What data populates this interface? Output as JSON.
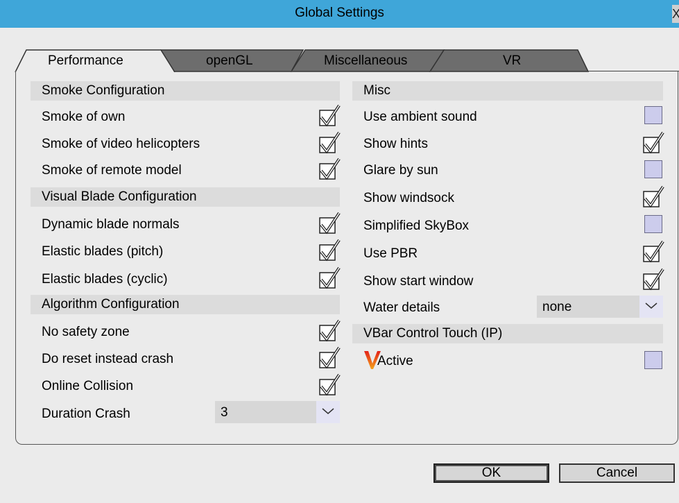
{
  "window": {
    "title": "Global Settings",
    "close_glyph": "X"
  },
  "tabs": [
    {
      "label": "Performance",
      "active": true
    },
    {
      "label": "openGL",
      "active": false
    },
    {
      "label": "Miscellaneous",
      "active": false
    },
    {
      "label": "VR",
      "active": false
    }
  ],
  "left": {
    "smoke": {
      "header": "Smoke Configuration",
      "items": [
        {
          "label": "Smoke of own",
          "checked": true
        },
        {
          "label": "Smoke of video helicopters",
          "checked": true
        },
        {
          "label": "Smoke of remote model",
          "checked": true
        }
      ]
    },
    "blade": {
      "header": "Visual Blade Configuration",
      "items": [
        {
          "label": "Dynamic blade normals",
          "checked": true
        },
        {
          "label": "Elastic blades (pitch)",
          "checked": true
        },
        {
          "label": "Elastic blades (cyclic)",
          "checked": true
        }
      ]
    },
    "algorithm": {
      "header": "Algorithm Configuration",
      "items": [
        {
          "label": "No safety zone",
          "checked": true
        },
        {
          "label": "Do reset instead crash",
          "checked": true
        },
        {
          "label": "Online Collision",
          "checked": true
        }
      ],
      "duration_label": "Duration Crash",
      "duration_value": "3"
    }
  },
  "right": {
    "misc": {
      "header": "Misc",
      "items": [
        {
          "label": "Use ambient sound",
          "checked": false
        },
        {
          "label": "Show hints",
          "checked": true
        },
        {
          "label": "Glare by sun",
          "checked": false
        },
        {
          "label": "Show windsock",
          "checked": true
        },
        {
          "label": "Simplified SkyBox",
          "checked": false
        },
        {
          "label": "Use PBR",
          "checked": true
        },
        {
          "label": "Show start window",
          "checked": true
        }
      ],
      "water_label": "Water details",
      "water_value": "none"
    },
    "vbar": {
      "header": "VBar Control Touch (IP)",
      "active_label": "Active",
      "active_checked": false
    }
  },
  "buttons": {
    "ok": "OK",
    "cancel": "Cancel"
  },
  "icons": {
    "vbar_logo": "vbar-logo-icon",
    "check": "checkmark-icon",
    "dropdown": "chevron-down-icon",
    "close": "close-icon"
  }
}
